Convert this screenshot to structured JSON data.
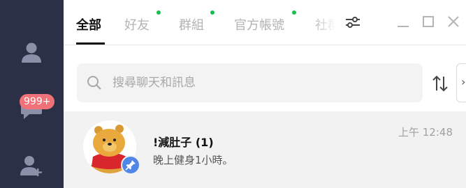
{
  "rail": {
    "items": [
      {
        "name": "friends",
        "icon": "person-icon"
      },
      {
        "name": "chats",
        "icon": "chat-bubble-icon",
        "badge": "999+"
      },
      {
        "name": "add-friend",
        "icon": "add-person-icon"
      }
    ]
  },
  "tabs": {
    "items": [
      {
        "label": "全部",
        "active": true,
        "dot": false
      },
      {
        "label": "好友",
        "active": false,
        "dot": true
      },
      {
        "label": "群組",
        "active": false,
        "dot": true
      },
      {
        "label": "官方帳號",
        "active": false,
        "dot": true
      },
      {
        "label": "社群",
        "active": false,
        "dot": false
      }
    ]
  },
  "window_controls": [
    "filter-settings-icon",
    "minimize-icon",
    "maximize-icon",
    "close-icon"
  ],
  "search": {
    "placeholder": "搜尋聊天和訊息",
    "value": ""
  },
  "side_button": "›",
  "chats": [
    {
      "name": "!減肚子 (1)",
      "preview": "晚上健身1小時。",
      "time": "上午 12:48",
      "pinned": true
    }
  ],
  "colors": {
    "rail": "#2b3046",
    "badge": "#f07278",
    "dot": "#16c04a",
    "pin": "#4f86e8",
    "selected_row": "#f2f2f3"
  }
}
